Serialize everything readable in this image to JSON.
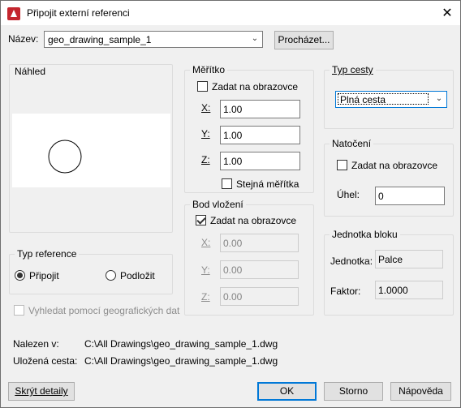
{
  "window": {
    "title": "Připojit externí referenci",
    "close_glyph": "✕"
  },
  "name_row": {
    "label": "Název:",
    "value": "geo_drawing_sample_1",
    "browse_button": "Procházet..."
  },
  "preview": {
    "label": "Náhled"
  },
  "scale": {
    "title": "Měřítko",
    "specify_onscreen": "Zadat na obrazovce",
    "x_label": "X:",
    "x_value": "1.00",
    "y_label": "Y:",
    "y_value": "1.00",
    "z_label": "Z:",
    "z_value": "1.00",
    "uniform_scale": "Stejná měřítka"
  },
  "insertion_point": {
    "title": "Bod vložení",
    "specify_onscreen": "Zadat na obrazovce",
    "x_label": "X:",
    "x_value": "0.00",
    "y_label": "Y:",
    "y_value": "0.00",
    "z_label": "Z:",
    "z_value": "0.00"
  },
  "path_type": {
    "title": "Typ cesty",
    "value": "Plná cesta"
  },
  "rotation": {
    "title": "Natočení",
    "specify_onscreen": "Zadat na obrazovce",
    "angle_label": "Úhel:",
    "angle_value": "0"
  },
  "block_unit": {
    "title": "Jednotka bloku",
    "unit_label": "Jednotka:",
    "unit_value": "Palce",
    "factor_label": "Faktor:",
    "factor_value": "1.0000"
  },
  "reference_type": {
    "title": "Typ reference",
    "attach": "Připojit",
    "overlay": "Podložit"
  },
  "geo_locate": "Vyhledat pomocí geografických dat",
  "paths": {
    "found_in_label": "Nalezen v:",
    "found_in_value": "C:\\All Drawings\\geo_drawing_sample_1.dwg",
    "saved_path_label": "Uložená cesta:",
    "saved_path_value": "C:\\All Drawings\\geo_drawing_sample_1.dwg"
  },
  "buttons": {
    "hide_details": "Skrýt detaily",
    "ok": "OK",
    "cancel": "Storno",
    "help": "Nápověda"
  },
  "colors": {
    "dialog_bg": "#f0f0f0",
    "accent_border": "#0078d7",
    "disabled_text": "#8d8d8d"
  }
}
